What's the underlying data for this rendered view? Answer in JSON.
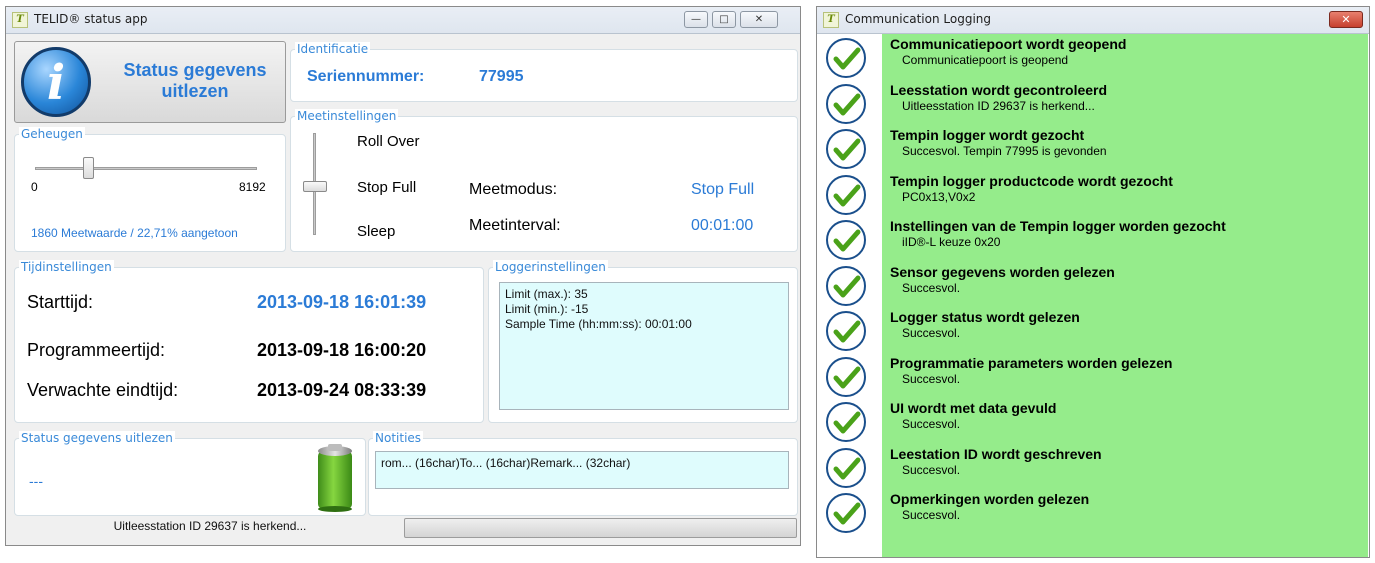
{
  "main_window": {
    "title": "TELID® status app",
    "app_icon": "T",
    "minimize_glyph": "—",
    "maximize_glyph": "□",
    "close_glyph": "✕",
    "status_button_label": "Status gegevens uitlezen",
    "identificatie": {
      "legend": "Identificatie",
      "serial_label": "Seriennummer:",
      "serial_value": "77995"
    },
    "geheugen": {
      "legend": "Geheugen",
      "min": "0",
      "max": "8192",
      "info": "1860 Meetwaarde / 22,71% aangetoon"
    },
    "meetinstellingen": {
      "legend": "Meetinstellingen",
      "options": [
        "Roll Over",
        "Stop Full",
        "Sleep"
      ],
      "mode_label": "Meetmodus:",
      "mode_value": "Stop Full",
      "interval_label": "Meetinterval:",
      "interval_value": "00:01:00"
    },
    "tijdinstellingen": {
      "legend": "Tijdinstellingen",
      "start_label": "Starttijd:",
      "start_value": "2013-09-18 16:01:39",
      "program_label": "Programmeertijd:",
      "program_value": "2013-09-18 16:00:20",
      "end_label": "Verwachte eindtijd:",
      "end_value": "2013-09-24 08:33:39"
    },
    "loggerinstellingen": {
      "legend": "Loggerinstellingen",
      "lines": [
        "Limit (max.): 35",
        "Limit (min.): -15",
        "Sample Time (hh:mm:ss): 00:01:00"
      ]
    },
    "status_panel": {
      "legend": "Status gegevens uitlezen",
      "value": "---"
    },
    "notities": {
      "legend": "Notities",
      "text": "rom... (16char)To... (16char)Remark... (32char)"
    },
    "status_bar": "Uitleesstation ID 29637 is herkend..."
  },
  "log_window": {
    "title": "Communication Logging",
    "close_glyph": "✕",
    "entries": [
      {
        "title": "Communicatiepoort wordt geopend",
        "detail": "Communicatiepoort is geopend"
      },
      {
        "title": "Leesstation wordt gecontroleerd",
        "detail": "Uitleesstation ID 29637 is herkend..."
      },
      {
        "title": "Tempin logger wordt gezocht",
        "detail": "Succesvol. Tempin 77995 is gevonden"
      },
      {
        "title": "Tempin logger productcode wordt gezocht",
        "detail": "PC0x13,V0x2"
      },
      {
        "title": "Instellingen van de Tempin logger worden gezocht",
        "detail": "iID®-L keuze 0x20"
      },
      {
        "title": "Sensor gegevens worden gelezen",
        "detail": "Succesvol."
      },
      {
        "title": "Logger status wordt gelezen",
        "detail": "Succesvol."
      },
      {
        "title": "Programmatie parameters worden gelezen",
        "detail": "Succesvol."
      },
      {
        "title": "UI wordt met data gevuld",
        "detail": "Succesvol."
      },
      {
        "title": "Leestation ID wordt geschreven",
        "detail": "Succesvol."
      },
      {
        "title": "Opmerkingen worden gelezen",
        "detail": "Succesvol."
      }
    ]
  },
  "colors": {
    "accent_blue": "#2b7bd6",
    "log_green": "#95ec8b",
    "notes_bg": "#dffcfd",
    "battery_green": "#5fae2a"
  },
  "icons": [
    "app-logo-icon",
    "info-icon",
    "battery-icon",
    "check-icon"
  ]
}
